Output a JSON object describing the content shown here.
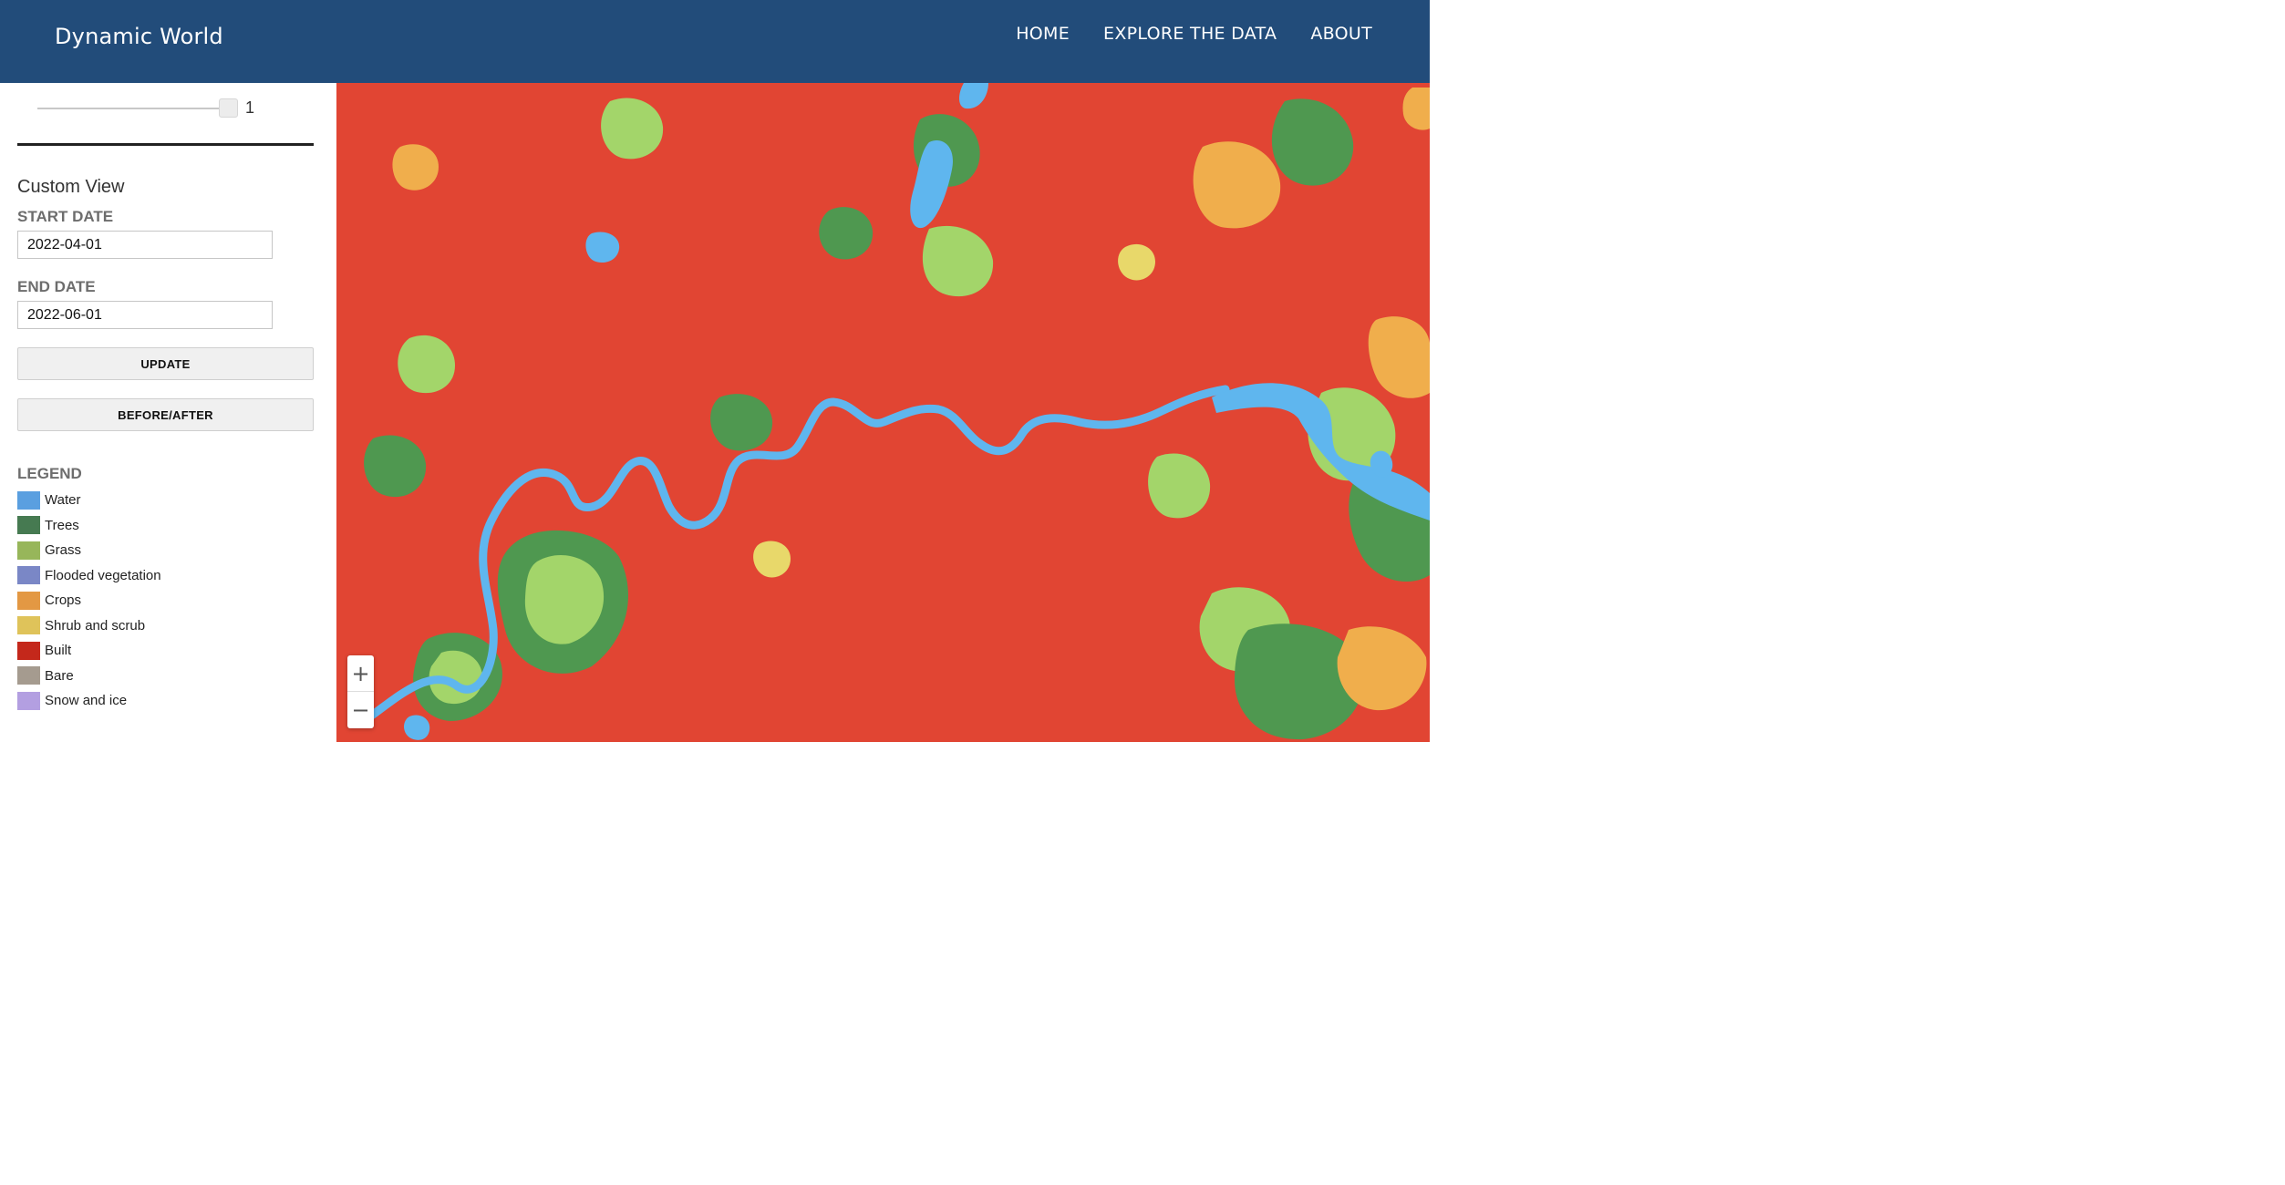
{
  "header": {
    "brand": "Dynamic World",
    "nav": [
      "HOME",
      "EXPLORE THE DATA",
      "ABOUT"
    ]
  },
  "sidebar": {
    "slider": {
      "value": "1"
    },
    "custom_view": {
      "title": "Custom View",
      "start_label": "START DATE",
      "start_value": "2022-04-01",
      "end_label": "END DATE",
      "end_value": "2022-06-01",
      "update_label": "UPDATE",
      "before_after_label": "BEFORE/AFTER"
    },
    "legend": {
      "title": "LEGEND",
      "items": [
        {
          "label": "Water",
          "color": "#5a9fe0"
        },
        {
          "label": "Trees",
          "color": "#467a51"
        },
        {
          "label": "Grass",
          "color": "#97b65a"
        },
        {
          "label": "Flooded vegetation",
          "color": "#7a87c6"
        },
        {
          "label": "Crops",
          "color": "#e39843"
        },
        {
          "label": "Shrub and scrub",
          "color": "#dfc35a"
        },
        {
          "label": "Built",
          "color": "#c4281b"
        },
        {
          "label": "Bare",
          "color": "#a59b8f"
        },
        {
          "label": "Snow and ice",
          "color": "#b39fe1"
        }
      ]
    }
  },
  "map": {
    "colors": {
      "built": "#e14533",
      "water": "#5fb6ee",
      "trees": "#4f9850",
      "grass": "#a3d56a",
      "crops": "#f0ae4c",
      "shrub": "#e8d86a"
    },
    "zoom_in_icon": "+",
    "zoom_out_icon": "−"
  }
}
